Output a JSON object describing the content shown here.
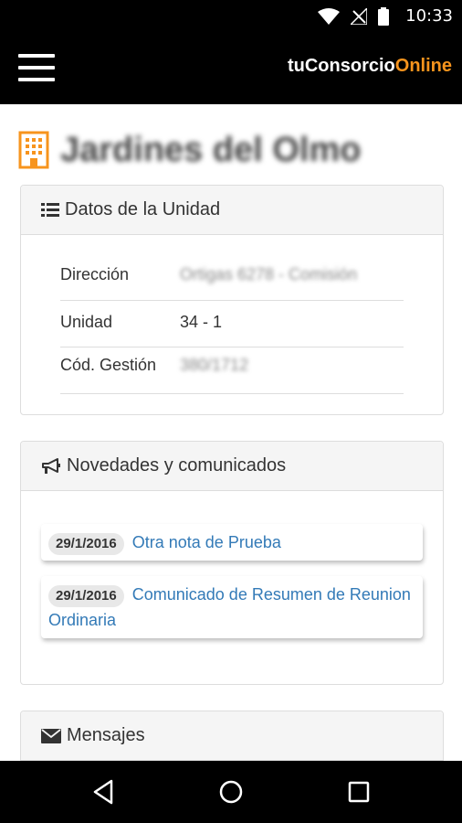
{
  "status_bar": {
    "time": "10:33",
    "icons": [
      "wifi-icon",
      "no-signal-icon",
      "battery-icon"
    ]
  },
  "app_bar": {
    "brand_prefix": "tuConsorcio",
    "brand_suffix": "Online",
    "brand_accent": "#f7941d"
  },
  "page": {
    "title": "Jardines del Olmo",
    "title_icon": "building-icon"
  },
  "unit_panel": {
    "heading": "Datos de la Unidad",
    "icon": "list-icon",
    "rows": [
      {
        "label": "Dirección",
        "value": "Ortigas 6278 - Comisión"
      },
      {
        "label": "Unidad",
        "value": "34 - 1"
      },
      {
        "label": "Cód. Gestión",
        "value": "380/1712"
      }
    ]
  },
  "news_panel": {
    "heading": "Novedades y comunicados",
    "icon": "bullhorn-icon",
    "items": [
      {
        "date": "29/1/2016",
        "title": "Otra nota de Prueba"
      },
      {
        "date": "29/1/2016",
        "title": "Comunicado de Resumen de Reunion Ordinaria"
      }
    ]
  },
  "messages_panel": {
    "heading": "Mensajes",
    "icon": "envelope-icon"
  },
  "nav_bar": {
    "buttons": [
      "back-icon",
      "home-icon",
      "recents-icon"
    ]
  }
}
